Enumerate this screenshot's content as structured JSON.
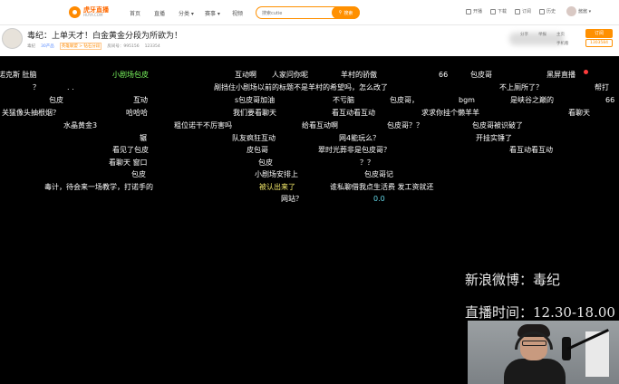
{
  "topbar": {
    "logo_line1": "虎牙直播",
    "logo_line2": "HUYA.COM",
    "nav": [
      "首页",
      "直播",
      "分类 ▾",
      "赛事 ▾",
      "视频"
    ],
    "search_placeholder": "搜索cutie",
    "search_button": "搜索",
    "tools": [
      "开播",
      "下载",
      "订阅",
      "历史"
    ],
    "user_label": "酱酱 ▾"
  },
  "room": {
    "title": "毒纪：上单天才！白金黄金分段为所欲为！",
    "meta": [
      "毒纪",
      "30产品",
      "英雄联盟 > 钻石分段",
      "房间号：995156",
      "123354"
    ],
    "right_tools": [
      "分享",
      "举报",
      "主页",
      "手机看"
    ],
    "subscribe_label": "订阅",
    "subscribe_count": "1303584"
  },
  "stream": {
    "weibo_text": "新浪微博：毒纪",
    "live_time_text": "直播时间：12.30-18.00",
    "danmaku": [
      {
        "text": "诺克斯 肚脑",
        "color": "white"
      },
      {
        "text": "小剧场包皮",
        "color": "green"
      },
      {
        "text": "互动啊",
        "color": "white"
      },
      {
        "text": "人家问你呢",
        "color": "white"
      },
      {
        "text": "羊村的骄傲",
        "color": "white"
      },
      {
        "text": "66",
        "color": "white"
      },
      {
        "text": "包皮哥",
        "color": "white"
      },
      {
        "text": "黑屏直播",
        "color": "white"
      },
      {
        "text": "？",
        "color": "white"
      },
      {
        "text": ". .",
        "color": "white"
      },
      {
        "text": "剐挡住小剧场以前的标题不是羊村的希望吗，怎么改了",
        "color": "white"
      },
      {
        "text": "不上厕所了？",
        "color": "white"
      },
      {
        "text": "帮打",
        "color": "white"
      },
      {
        "text": ". . .",
        "color": "white"
      },
      {
        "text": "包皮",
        "color": "white"
      },
      {
        "text": "互动",
        "color": "white"
      },
      {
        "text": "s包皮哥加油",
        "color": "white"
      },
      {
        "text": "不亏脑",
        "color": "white"
      },
      {
        "text": "包皮哥，",
        "color": "white"
      },
      {
        "text": "bgm",
        "color": "white"
      },
      {
        "text": "是峡谷之巅的",
        "color": "white"
      },
      {
        "text": "66",
        "color": "white"
      },
      {
        "text": "关猛像头抽根烟？",
        "color": "white"
      },
      {
        "text": "哈哈哈",
        "color": "white"
      },
      {
        "text": "我们要看聊天",
        "color": "white"
      },
      {
        "text": "看互动看互动",
        "color": "white"
      },
      {
        "text": "求求你挂个懒羊羊",
        "color": "white"
      },
      {
        "text": "看聊天",
        "color": "white"
      },
      {
        "text": "水晶黄金3",
        "color": "white"
      },
      {
        "text": "粗位诺干不厉害吗",
        "color": "white"
      },
      {
        "text": "给看互动啊",
        "color": "white"
      },
      {
        "text": "包皮哥？？",
        "color": "white"
      },
      {
        "text": "包皮哥被识破了",
        "color": "white"
      },
      {
        "text": "辗",
        "color": "white"
      },
      {
        "text": "队友疯狂互动",
        "color": "white"
      },
      {
        "text": "网4能玩么？",
        "color": "white"
      },
      {
        "text": "开挂实锤了",
        "color": "white"
      },
      {
        "text": "看见了包皮",
        "color": "white"
      },
      {
        "text": "皮包哥",
        "color": "white"
      },
      {
        "text": "翠时光葬非是包皮哥？",
        "color": "white"
      },
      {
        "text": "看互动看互动",
        "color": "white"
      },
      {
        "text": "看聊天 窗口",
        "color": "white"
      },
      {
        "text": "包皮",
        "color": "white"
      },
      {
        "text": "？？",
        "color": "white"
      },
      {
        "text": "包皮",
        "color": "white"
      },
      {
        "text": "小剧场安排上",
        "color": "white"
      },
      {
        "text": "包皮哥记",
        "color": "white"
      },
      {
        "text": "毒计，待会来一场教学，打诺手的",
        "color": "white"
      },
      {
        "text": "被认出来了",
        "color": "yellow"
      },
      {
        "text": "谁私聊借我点生活费 发工资就还",
        "color": "white"
      },
      {
        "text": "网站？",
        "color": "white"
      },
      {
        "text": "0.0",
        "color": "cyan"
      }
    ]
  }
}
